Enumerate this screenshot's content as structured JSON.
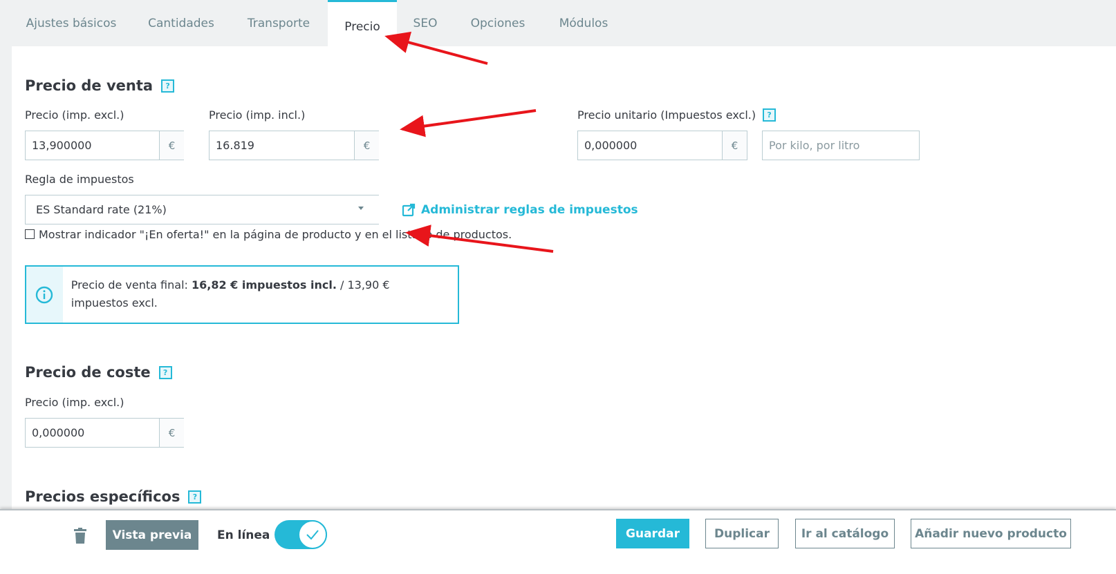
{
  "tabs": [
    {
      "label": "Ajustes básicos",
      "active": false
    },
    {
      "label": "Cantidades",
      "active": false
    },
    {
      "label": "Transporte",
      "active": false
    },
    {
      "label": "Precio",
      "active": true
    },
    {
      "label": "SEO",
      "active": false
    },
    {
      "label": "Opciones",
      "active": false
    },
    {
      "label": "Módulos",
      "active": false
    }
  ],
  "sale_price": {
    "title": "Precio de venta",
    "help": "?",
    "price_excl_label": "Precio (imp. excl.)",
    "price_excl_value": "13,900000",
    "price_incl_label": "Precio (imp. incl.)",
    "price_incl_value": "16.819",
    "currency": "€",
    "unit_price_label": "Precio unitario (Impuestos excl.)",
    "unit_price_value": "0,000000",
    "unit_placeholder": "Por kilo, por litro",
    "tax_rule_label": "Regla de impuestos",
    "tax_rule_value": "ES Standard rate (21%)",
    "manage_tax_link": "Administrar reglas de impuestos",
    "on_sale_label": "Mostrar indicador \"¡En oferta!\" en la página de producto y en el listado de productos.",
    "final_price_prefix": "Precio de venta final: ",
    "final_price_incl": "16,82 € impuestos incl.",
    "final_price_sep": " / ",
    "final_price_excl": "13,90 € impuestos excl."
  },
  "cost_price": {
    "title": "Precio de coste",
    "help": "?",
    "price_excl_label": "Precio (imp. excl.)",
    "price_excl_value": "0,000000",
    "currency": "€"
  },
  "specific_prices": {
    "title": "Precios específicos"
  },
  "footer": {
    "preview_label": "Vista previa",
    "online_label": "En línea",
    "online_on": true,
    "save_label": "Guardar",
    "duplicate_label": "Duplicar",
    "catalog_label": "Ir al catálogo",
    "new_product_label": "Añadir nuevo producto"
  },
  "colors": {
    "accent": "#25b9d7",
    "annotation_arrow": "#e8151b"
  }
}
